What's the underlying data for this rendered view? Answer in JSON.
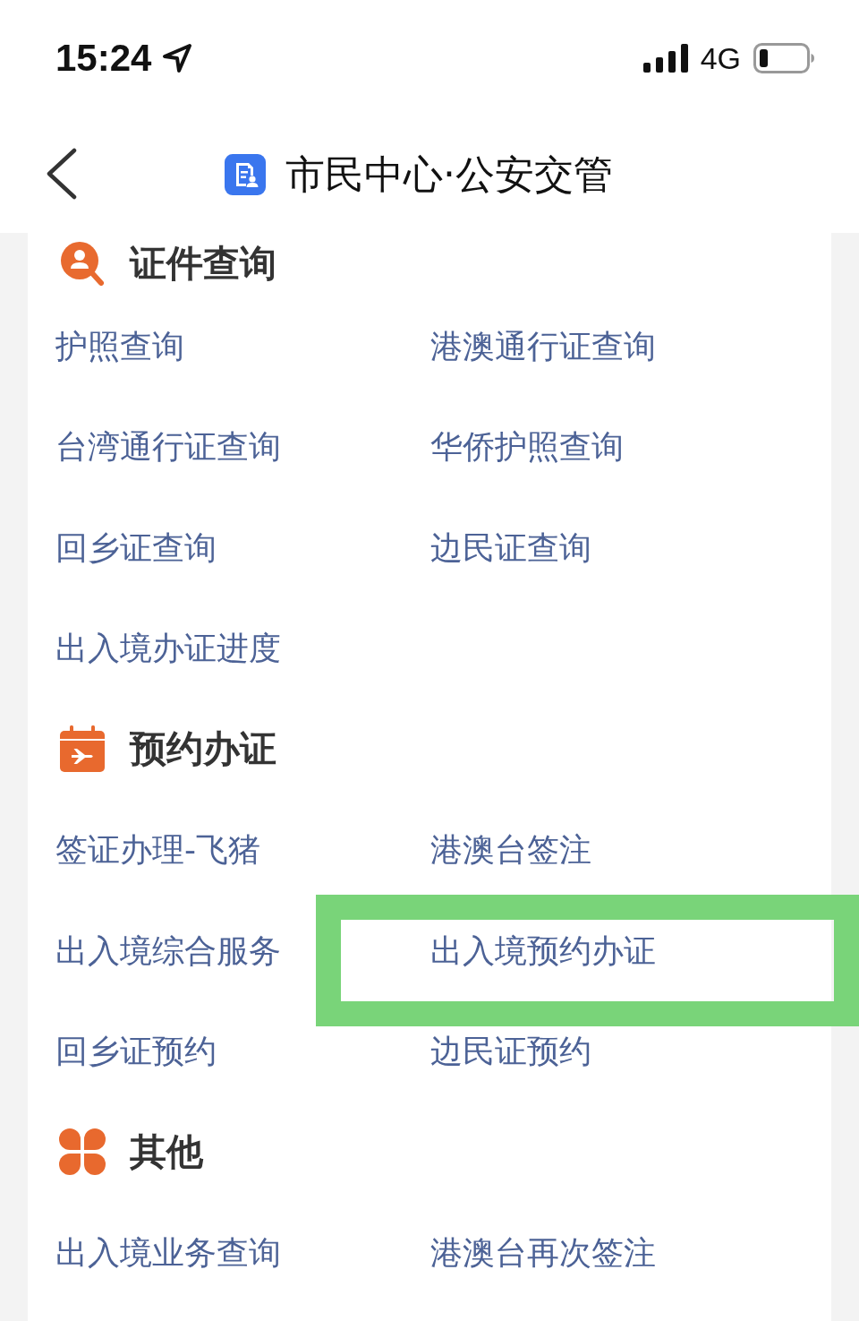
{
  "status_bar": {
    "time": "15:24",
    "network": "4G"
  },
  "nav_bar": {
    "title": "市民中心·公安交管"
  },
  "sections": [
    {
      "kind": "query",
      "title": "证件查询",
      "items": [
        {
          "label": "护照查询",
          "highlighted": false
        },
        {
          "label": "港澳通行证查询",
          "highlighted": false
        },
        {
          "label": "台湾通行证查询",
          "highlighted": false
        },
        {
          "label": "华侨护照查询",
          "highlighted": false
        },
        {
          "label": "回乡证查询",
          "highlighted": false
        },
        {
          "label": "边民证查询",
          "highlighted": false
        },
        {
          "label": "出入境办证进度",
          "highlighted": false
        }
      ]
    },
    {
      "kind": "booking",
      "title": "预约办证",
      "items": [
        {
          "label": "签证办理-飞猪",
          "highlighted": false
        },
        {
          "label": "港澳台签注",
          "highlighted": false
        },
        {
          "label": "出入境综合服务",
          "highlighted": false
        },
        {
          "label": "出入境预约办证",
          "highlighted": true
        },
        {
          "label": "回乡证预约",
          "highlighted": false
        },
        {
          "label": "边民证预约",
          "highlighted": false
        }
      ]
    },
    {
      "kind": "other",
      "title": "其他",
      "items": [
        {
          "label": "出入境业务查询",
          "highlighted": false
        },
        {
          "label": "港澳台再次签注",
          "highlighted": false
        }
      ]
    }
  ]
}
